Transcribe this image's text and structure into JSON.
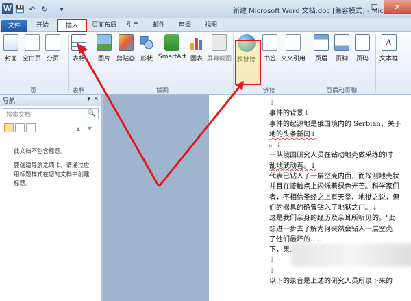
{
  "app": {
    "logo_letter": "W",
    "window_title": "新建 Microsoft Word 文档.doc [兼容模式] - Microsoft Word"
  },
  "quick_access": {
    "save": "💾",
    "undo": "↶",
    "redo": "↻",
    "more": "▾"
  },
  "window_controls": {
    "minimize": "—",
    "maximize": "☐",
    "close": "✕"
  },
  "tabs": [
    {
      "label": "文件"
    },
    {
      "label": "开始"
    },
    {
      "label": "插入"
    },
    {
      "label": "页面布局"
    },
    {
      "label": "引用"
    },
    {
      "label": "邮件"
    },
    {
      "label": "审阅"
    },
    {
      "label": "视图"
    }
  ],
  "active_tab": "插入",
  "ribbon": {
    "buttons": {
      "cover": "封面",
      "blank": "空白页",
      "pagebreak": "分页",
      "table": "表格",
      "picture": "图片",
      "clipart": "剪贴画",
      "shapes": "形状",
      "smartart": "SmartArt",
      "chart": "图表",
      "screenshot": "屏幕截图",
      "hyperlink": "超链接",
      "bookmark": "书签",
      "crossref": "交叉引用",
      "header": "页眉",
      "footer": "页脚",
      "pagenum": "页码",
      "textbox": "文本框"
    },
    "groups": {
      "pages": "页",
      "tables": "表格",
      "illustrations": "插图",
      "links": "链接",
      "header_footer": "页眉和页脚"
    },
    "icon_glyphs": {
      "textbox": "A"
    }
  },
  "nav": {
    "title": "导航",
    "pin": "▾",
    "close": "✕",
    "search_placeholder": "搜索文档",
    "search_glyph": "🔍",
    "arrows": "▲ ▼",
    "message1": "此文档不包含标题。",
    "message2": "要创建导航选项卡，请通过应用标题样式在您的文档中创建标题。"
  },
  "document": {
    "lines": [
      "↓",
      "事件的背景↓",
      "事件的起源地是俄国境内的 Serbian，关于",
      "地的头条新闻↓",
      "。↓",
      "一队俄国研究人员在钻动地壳做采练的时",
      "乱地武动着。↓",
      "代表已钻入了一层空壳内面，而探测地壳状",
      "并且在接触点上闪烁着绿色光芒。科学家们",
      "者，不相信圣经之上有天堂、地狱之说，但",
      "们的器具的确曾钻入了地狱之门。↓",
      "这是我们亲身的经历及亲耳所听见的。\"此",
      "想进一步去了解为何突然会钻入一层空壳",
      "了他们最坏的……",
      "下，果……",
      "↓",
      "↓",
      "以下的录音是上述的研究人员所录下来的"
    ]
  },
  "annotation_color": "#e3181b"
}
